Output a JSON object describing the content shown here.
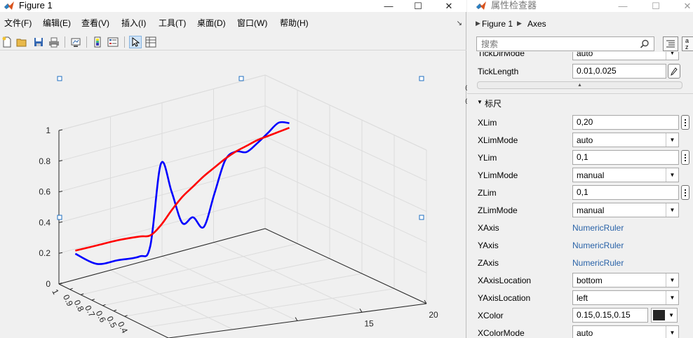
{
  "figure": {
    "title": "Figure 1",
    "menu": [
      "文件(F)",
      "编辑(E)",
      "查看(V)",
      "插入(I)",
      "工具(T)",
      "桌面(D)",
      "窗口(W)",
      "帮助(H)"
    ],
    "toolbar_icons": [
      "new-figure-icon",
      "open-file-icon",
      "save-icon",
      "print-icon",
      "link-plot-icon",
      "colorbar-icon",
      "legend-icon",
      "pointer-icon",
      "property-inspector-icon"
    ],
    "window_buttons": {
      "minimize": "—",
      "maximize": "☐",
      "close": "✕"
    }
  },
  "chart_data": {
    "type": "line",
    "projection": "3d",
    "xlim": [
      0,
      20
    ],
    "ylim": [
      0,
      1
    ],
    "zlim": [
      0,
      1
    ],
    "z_ticks": [
      "0",
      "0.2",
      "0.4",
      "0.6",
      "0.8",
      "1"
    ],
    "y_ticks": [
      "1",
      "0.9",
      "0.8",
      "0.7",
      "0.6",
      "0.5",
      "0.4"
    ],
    "x_ticks": [
      "15",
      "20"
    ],
    "grid": true,
    "series": [
      {
        "color": "#0000ff",
        "x": [
          0,
          2,
          4,
          6,
          7,
          8,
          9,
          10,
          11,
          12,
          13,
          14,
          15,
          16,
          17,
          18,
          19,
          20
        ],
        "y": [
          0.85,
          0.85,
          0.85,
          0.85,
          0.85,
          0.85,
          0.85,
          0.85,
          0.85,
          0.85,
          0.85,
          0.85,
          0.85,
          0.85,
          0.85,
          0.85,
          0.85,
          0.85
        ],
        "z": [
          0.25,
          0.15,
          0.14,
          0.13,
          0.18,
          0.7,
          0.5,
          0.28,
          0.3,
          0.22,
          0.42,
          0.62,
          0.66,
          0.64,
          0.68,
          0.73,
          0.78,
          0.76
        ]
      },
      {
        "color": "#ff0000",
        "x": [
          0,
          2,
          4,
          6,
          7,
          8,
          9,
          10,
          11,
          12,
          13,
          14,
          15,
          16,
          17,
          18,
          19,
          20
        ],
        "y": [
          0.85,
          0.85,
          0.85,
          0.85,
          0.85,
          0.85,
          0.85,
          0.85,
          0.85,
          0.85,
          0.85,
          0.85,
          0.85,
          0.85,
          0.85,
          0.85,
          0.85,
          0.85
        ],
        "z": [
          0.27,
          0.27,
          0.27,
          0.26,
          0.25,
          0.3,
          0.38,
          0.45,
          0.5,
          0.55,
          0.59,
          0.63,
          0.66,
          0.68,
          0.7,
          0.71,
          0.72,
          0.73
        ]
      }
    ]
  },
  "inspector": {
    "title": "属性检查器",
    "breadcrumb": {
      "figure": "Figure 1",
      "axes": "Axes"
    },
    "search_placeholder": "搜索",
    "sort_label": "a\nz",
    "top_partial_label": "TickDirMode",
    "top_partial_value": "auto",
    "ticklength": {
      "label": "TickLength",
      "value": "0.01,0.025"
    },
    "section_title": "标尺",
    "rows": [
      {
        "label": "XLim",
        "kind": "text",
        "value": "0,20"
      },
      {
        "label": "XLimMode",
        "kind": "select",
        "value": "auto"
      },
      {
        "label": "YLim",
        "kind": "text",
        "value": "0,1"
      },
      {
        "label": "YLimMode",
        "kind": "select",
        "value": "manual"
      },
      {
        "label": "ZLim",
        "kind": "text",
        "value": "0,1"
      },
      {
        "label": "ZLimMode",
        "kind": "select",
        "value": "manual"
      },
      {
        "label": "XAxis",
        "kind": "link",
        "value": "NumericRuler"
      },
      {
        "label": "YAxis",
        "kind": "link",
        "value": "NumericRuler"
      },
      {
        "label": "ZAxis",
        "kind": "link",
        "value": "NumericRuler"
      },
      {
        "label": "XAxisLocation",
        "kind": "select",
        "value": "bottom"
      },
      {
        "label": "YAxisLocation",
        "kind": "select",
        "value": "left"
      },
      {
        "label": "XColor",
        "kind": "color",
        "value": "0.15,0.15,0.15",
        "color": "#262626"
      },
      {
        "label": "XColorMode",
        "kind": "select",
        "value": "auto"
      }
    ]
  }
}
